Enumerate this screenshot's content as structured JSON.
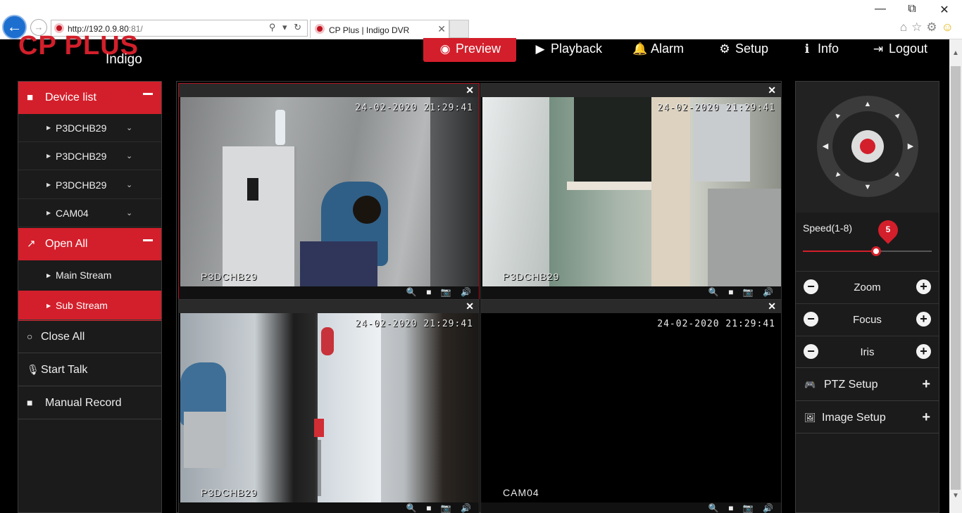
{
  "browser": {
    "url_host": "http://192.0.9.80",
    "url_port": ":81/",
    "tab_title": "CP Plus | Indigo DVR",
    "address_tools": "⚲ ▾ ↻",
    "tab_close": "✕",
    "back_icon": "←",
    "forward_icon": "→",
    "minimize": "—",
    "restore": "⧉",
    "close": "✕"
  },
  "logo": {
    "brand": "CP PLUS",
    "product": "Indigo"
  },
  "nav": [
    {
      "label": "Preview",
      "icon": "eye-icon",
      "glyph": "◉",
      "active": true
    },
    {
      "label": "Playback",
      "icon": "play-circle-icon",
      "glyph": "▶"
    },
    {
      "label": "Alarm",
      "icon": "bell-icon",
      "glyph": "🔔"
    },
    {
      "label": "Setup",
      "icon": "gear-icon",
      "glyph": "⚙"
    },
    {
      "label": "Info",
      "icon": "info-icon",
      "glyph": "ℹ"
    },
    {
      "label": "Logout",
      "icon": "logout-icon",
      "glyph": "⇥"
    }
  ],
  "sidebar": {
    "device_list": {
      "label": "Device list",
      "icon": "video-camera-icon",
      "glyph": "■"
    },
    "devices": [
      "P3DCHB29",
      "P3DCHB29",
      "P3DCHB29",
      "CAM04"
    ],
    "open_all": {
      "label": "Open All",
      "icon": "external-link-icon",
      "glyph": "↗"
    },
    "streams": [
      {
        "label": "Main Stream",
        "active": false
      },
      {
        "label": "Sub Stream",
        "active": true
      }
    ],
    "actions": [
      {
        "label": "Close All",
        "icon": "circle-outline-icon",
        "glyph": "○"
      },
      {
        "label": "Start Talk",
        "icon": "microphone-icon",
        "glyph": "🎙"
      },
      {
        "label": "Manual Record",
        "icon": "video-camera-icon",
        "glyph": "■"
      }
    ]
  },
  "video": {
    "close_glyph": "✕",
    "toolbar_glyphs": "🔍 ■ 📷 🔊",
    "cells": [
      {
        "timestamp": "24-02-2020 21:29:41",
        "name": "P3DCHB29"
      },
      {
        "timestamp": "24-02-2020 21:29:41",
        "name": "P3DCHB29"
      },
      {
        "timestamp": "24-02-2020 21:29:41",
        "name": "P3DCHB29"
      },
      {
        "timestamp": "24-02-2020 21:29:41",
        "name": "CAM04"
      }
    ]
  },
  "ptz": {
    "speed_label": "Speed(1-8)",
    "speed_value": "5",
    "speed_fraction": 0.57,
    "controls": [
      {
        "label": "Zoom"
      },
      {
        "label": "Focus"
      },
      {
        "label": "Iris"
      }
    ],
    "minus_glyph": "−",
    "plus_glyph": "+",
    "settings": [
      {
        "label": "PTZ Setup",
        "icon": "gamepad-icon",
        "glyph": "🎮"
      },
      {
        "label": "Image Setup",
        "icon": "image-icon",
        "glyph": "🖼"
      }
    ],
    "add_glyph": "+"
  },
  "colors": {
    "accent": "#d31f2b",
    "panel": "#1b1b1b",
    "background": "#000000"
  }
}
